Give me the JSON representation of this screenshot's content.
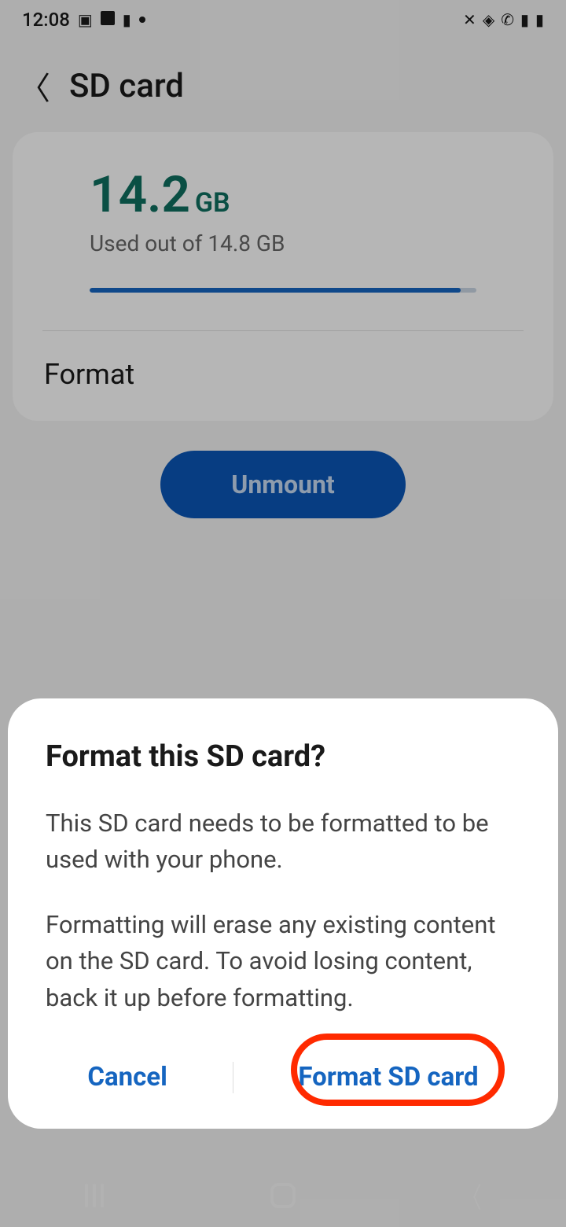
{
  "statusBar": {
    "time": "12:08"
  },
  "header": {
    "title": "SD card"
  },
  "storage": {
    "usedValue": "14.2",
    "usedUnit": "GB",
    "subtitle": "Used out of 14.8 GB",
    "progressPercent": 96
  },
  "actions": {
    "formatLabel": "Format",
    "unmountLabel": "Unmount"
  },
  "dialog": {
    "title": "Format this SD card?",
    "paragraph1": "This SD card needs to be formatted to be used with your phone.",
    "paragraph2": "Formatting will erase any existing content on the SD card. To avoid losing content, back it up before formatting.",
    "cancelLabel": "Cancel",
    "confirmLabel": "Format SD card"
  }
}
